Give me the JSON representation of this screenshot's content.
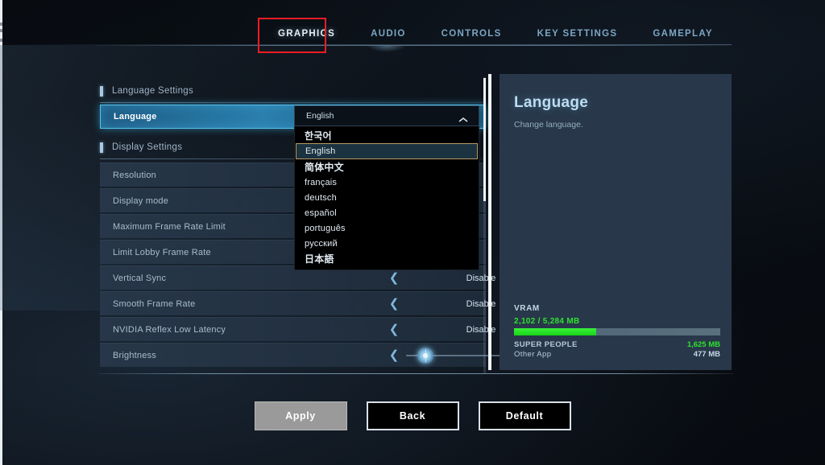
{
  "tabs": [
    {
      "label": "GRAPHICS",
      "active": true
    },
    {
      "label": "AUDIO",
      "active": false
    },
    {
      "label": "CONTROLS",
      "active": false
    },
    {
      "label": "KEY SETTINGS",
      "active": false
    },
    {
      "label": "GAMEPLAY",
      "active": false
    }
  ],
  "sections": [
    {
      "title": "Language Settings",
      "rows": [
        {
          "label": "Language",
          "type": "dropdown",
          "active": true
        }
      ]
    },
    {
      "title": "Display Settings",
      "rows": [
        {
          "label": "Resolution",
          "type": "stepper",
          "value": ""
        },
        {
          "label": "Display mode",
          "type": "stepper",
          "value": ""
        },
        {
          "label": "Maximum Frame Rate Limit",
          "type": "stepper",
          "value": ""
        },
        {
          "label": "Limit Lobby Frame Rate",
          "type": "stepper",
          "value": ""
        },
        {
          "label": "Vertical Sync",
          "type": "stepper",
          "value": "Disable"
        },
        {
          "label": "Smooth Frame Rate",
          "type": "stepper",
          "value": "Disable"
        },
        {
          "label": "NVIDIA Reflex Low Latency",
          "type": "stepper",
          "value": "Disable"
        },
        {
          "label": "Brightness",
          "type": "slider",
          "value": "2.2"
        }
      ]
    }
  ],
  "dropdown": {
    "selected_label": "English",
    "expanded": true,
    "chevron": "chevron-up-icon",
    "options": [
      {
        "label": "한국어",
        "selected": false,
        "cjk": true
      },
      {
        "label": "English",
        "selected": true,
        "cjk": false
      },
      {
        "label": "简体中文",
        "selected": false,
        "cjk": true
      },
      {
        "label": "français",
        "selected": false,
        "cjk": false
      },
      {
        "label": "deutsch",
        "selected": false,
        "cjk": false
      },
      {
        "label": "español",
        "selected": false,
        "cjk": false
      },
      {
        "label": "português",
        "selected": false,
        "cjk": false
      },
      {
        "label": "русский",
        "selected": false,
        "cjk": false
      },
      {
        "label": "日本語",
        "selected": false,
        "cjk": true
      }
    ]
  },
  "info": {
    "title": "Language",
    "description": "Change language.",
    "vram": {
      "heading": "VRAM",
      "usage_text": "2,102 / 5,284 MB",
      "used_mb": 2102,
      "total_mb": 5284,
      "fill_percent": 39.8,
      "entries": [
        {
          "name": "SUPER PEOPLE",
          "value": "1,625 MB",
          "highlight": true
        },
        {
          "name": "Other App",
          "value": "477 MB",
          "highlight": false
        }
      ]
    }
  },
  "footer": {
    "apply_label": "Apply",
    "back_label": "Back",
    "default_label": "Default"
  },
  "colors": {
    "accent_cyan": "#53c3f0",
    "highlight_blue": "#2a7fad",
    "vram_green": "#2fe22f",
    "annotation_red": "#ee1c24",
    "panel_bg": "#28384a"
  }
}
